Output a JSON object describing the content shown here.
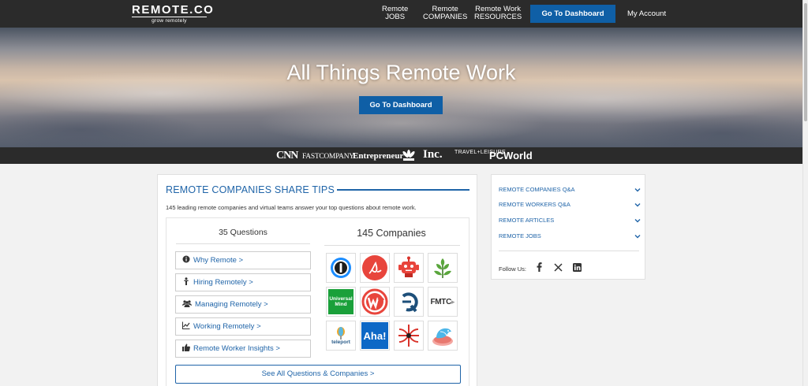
{
  "header": {
    "logo_text": "REMOTE.CO",
    "logo_tagline": "grow remotely",
    "nav": [
      {
        "line1": "Remote",
        "line2": "JOBS"
      },
      {
        "line1": "Remote",
        "line2": "COMPANIES"
      },
      {
        "line1": "Remote Work",
        "line2": "RESOURCES"
      }
    ],
    "dashboard_button": "Go To Dashboard",
    "account_link": "My Account"
  },
  "hero": {
    "title": "All Things Remote Work",
    "button": "Go To Dashboard"
  },
  "press_logos": [
    "CNN",
    "FASTCOMPANY",
    "Entrepreneur",
    "NBC",
    "Inc.",
    "TRAVEL+LEISURE",
    "PCWorld"
  ],
  "main": {
    "section_title": "REMOTE COMPANIES SHARE TIPS",
    "subtitle": "145 leading remote companies and virtual teams answer your top questions about remote work.",
    "questions_heading": "35 Questions",
    "companies_heading": "145 Companies",
    "questions": [
      {
        "label": "Why Remote >",
        "icon": "info-circle-icon"
      },
      {
        "label": "Hiring Remotely >",
        "icon": "person-icon"
      },
      {
        "label": "Managing Remotely >",
        "icon": "users-icon"
      },
      {
        "label": "Working Remotely >",
        "icon": "line-chart-icon"
      },
      {
        "label": "Remote Worker Insights >",
        "icon": "thumbs-up-icon"
      }
    ],
    "companies": [
      {
        "name": "1Password",
        "text": ""
      },
      {
        "name": "Articulate",
        "text": ""
      },
      {
        "name": "Zapier robot",
        "text": ""
      },
      {
        "name": "Green leaf company",
        "text": ""
      },
      {
        "name": "Universal Mind",
        "text": "Universal Mind"
      },
      {
        "name": "Wikimedia W",
        "text": ""
      },
      {
        "name": "Q logo company",
        "text": ""
      },
      {
        "name": "FMTC",
        "text": "FMTC"
      },
      {
        "name": "Teleport",
        "text": "teleport"
      },
      {
        "name": "Aha!",
        "text": "Aha!"
      },
      {
        "name": "Red radial company",
        "text": ""
      },
      {
        "name": "Bird company",
        "text": ""
      }
    ],
    "see_all_button": "See All Questions & Companies >"
  },
  "sidebar": {
    "items": [
      "REMOTE COMPANIES Q&A",
      "REMOTE WORKERS Q&A",
      "REMOTE ARTICLES",
      "REMOTE JOBS"
    ],
    "follow_label": "Follow Us:",
    "social": [
      "facebook-icon",
      "x-icon",
      "linkedin-icon"
    ]
  },
  "colors": {
    "header_bg": "#2b2b2b",
    "accent_blue": "#0f5fa6",
    "link_blue": "#1f64a8",
    "page_bg": "#f2f2f2"
  }
}
